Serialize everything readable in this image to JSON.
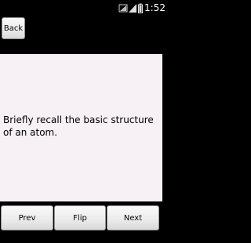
{
  "status_bar": {
    "time": "1:52",
    "icons": [
      "wifi-icon",
      "signal-icon",
      "battery-icon"
    ]
  },
  "toolbar": {
    "back_label": "Back"
  },
  "card": {
    "text": "Briefly recall the basic structure of an atom."
  },
  "navigation": {
    "prev_label": "Prev",
    "flip_label": "Flip",
    "next_label": "Next"
  },
  "colors": {
    "background": "#000000",
    "card_background": "#f7f1f5",
    "button_face": "#ececec",
    "text": "#000000",
    "status_text": "#ffffff"
  }
}
